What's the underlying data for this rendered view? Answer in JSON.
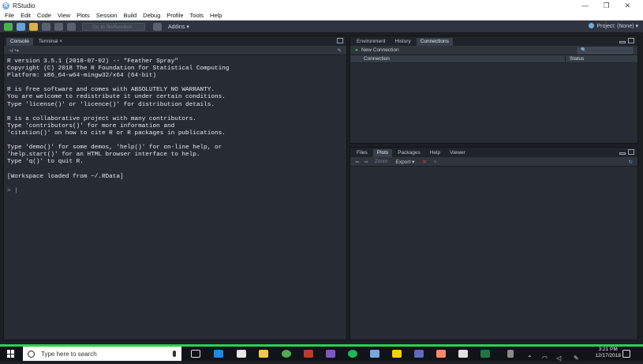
{
  "app": {
    "title": "RStudio"
  },
  "window_controls": {
    "minimize": "—",
    "maximize": "❐",
    "close": "✕"
  },
  "menu": [
    "File",
    "Edit",
    "Code",
    "View",
    "Plots",
    "Session",
    "Build",
    "Debug",
    "Profile",
    "Tools",
    "Help"
  ],
  "toolbar": {
    "goto_placeholder": "Go to file/function",
    "addins": "Addins ▾",
    "project": "Project: (None) ▾"
  },
  "console_pane": {
    "tabs": [
      "Console",
      "Terminal ×"
    ],
    "path": "~/ ↪",
    "lines": [
      "R version 3.5.1 (2018-07-02) -- \"Feather Spray\"",
      "Copyright (C) 2018 The R Foundation for Statistical Computing",
      "Platform: x86_64-w64-mingw32/x64 (64-bit)",
      "",
      "R is free software and comes with ABSOLUTELY NO WARRANTY.",
      "You are welcome to redistribute it under certain conditions.",
      "Type 'license()' or 'licence()' for distribution details.",
      "",
      "R is a collaborative project with many contributors.",
      "Type 'contributors()' for more information and",
      "'citation()' on how to cite R or R packages in publications.",
      "",
      "Type 'demo()' for some demos, 'help()' for on-line help, or",
      "'help.start()' for an HTML browser interface to help.",
      "Type 'q()' to quit R.",
      "",
      "[Workspace loaded from ~/.RData]",
      "",
      "> |"
    ]
  },
  "top_right_pane": {
    "tabs": [
      "Environment",
      "History",
      "Connections"
    ],
    "new_connection": "New Connection",
    "columns": [
      "Connection",
      "Status"
    ]
  },
  "bottom_right_pane": {
    "tabs": [
      "Files",
      "Plots",
      "Packages",
      "Help",
      "Viewer"
    ],
    "zoom": "Zoom",
    "export": "Export ▾"
  },
  "taskbar": {
    "search_placeholder": "Type here to search",
    "time": "3:21 PM",
    "date": "12/17/2018"
  },
  "colors": {
    "accent": "#75aadb",
    "taskbar_strip": "#29d34a"
  }
}
